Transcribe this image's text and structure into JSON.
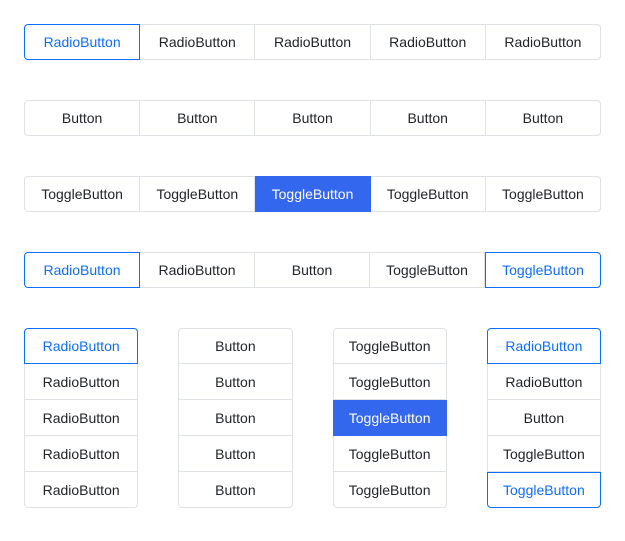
{
  "label": {
    "radio": "RadioButton",
    "button": "Button",
    "toggle": "ToggleButton"
  },
  "row1": [
    {
      "t": "radio",
      "checked": true
    },
    {
      "t": "radio",
      "checked": false
    },
    {
      "t": "radio",
      "checked": false
    },
    {
      "t": "radio",
      "checked": false
    },
    {
      "t": "radio",
      "checked": false
    }
  ],
  "row2": [
    {
      "t": "button"
    },
    {
      "t": "button"
    },
    {
      "t": "button"
    },
    {
      "t": "button"
    },
    {
      "t": "button"
    }
  ],
  "row3": [
    {
      "t": "toggle",
      "checked": false
    },
    {
      "t": "toggle",
      "checked": false
    },
    {
      "t": "toggle",
      "checked": true
    },
    {
      "t": "toggle",
      "checked": false
    },
    {
      "t": "toggle",
      "checked": false
    }
  ],
  "row4": [
    {
      "t": "radio",
      "checked": true
    },
    {
      "t": "radio",
      "checked": false
    },
    {
      "t": "button"
    },
    {
      "t": "toggle",
      "checked": false
    },
    {
      "t": "toggle",
      "style": "outline",
      "checked": true
    }
  ],
  "colA": [
    {
      "t": "radio",
      "checked": true
    },
    {
      "t": "radio",
      "checked": false
    },
    {
      "t": "radio",
      "checked": false
    },
    {
      "t": "radio",
      "checked": false
    },
    {
      "t": "radio",
      "checked": false
    }
  ],
  "colB": [
    {
      "t": "button"
    },
    {
      "t": "button"
    },
    {
      "t": "button"
    },
    {
      "t": "button"
    },
    {
      "t": "button"
    }
  ],
  "colC": [
    {
      "t": "toggle",
      "checked": false
    },
    {
      "t": "toggle",
      "checked": false
    },
    {
      "t": "toggle",
      "checked": true
    },
    {
      "t": "toggle",
      "checked": false
    },
    {
      "t": "toggle",
      "checked": false
    }
  ],
  "colD": [
    {
      "t": "radio",
      "checked": true
    },
    {
      "t": "radio",
      "checked": false
    },
    {
      "t": "button"
    },
    {
      "t": "toggle",
      "checked": false
    },
    {
      "t": "toggle",
      "style": "outline",
      "checked": true
    }
  ]
}
